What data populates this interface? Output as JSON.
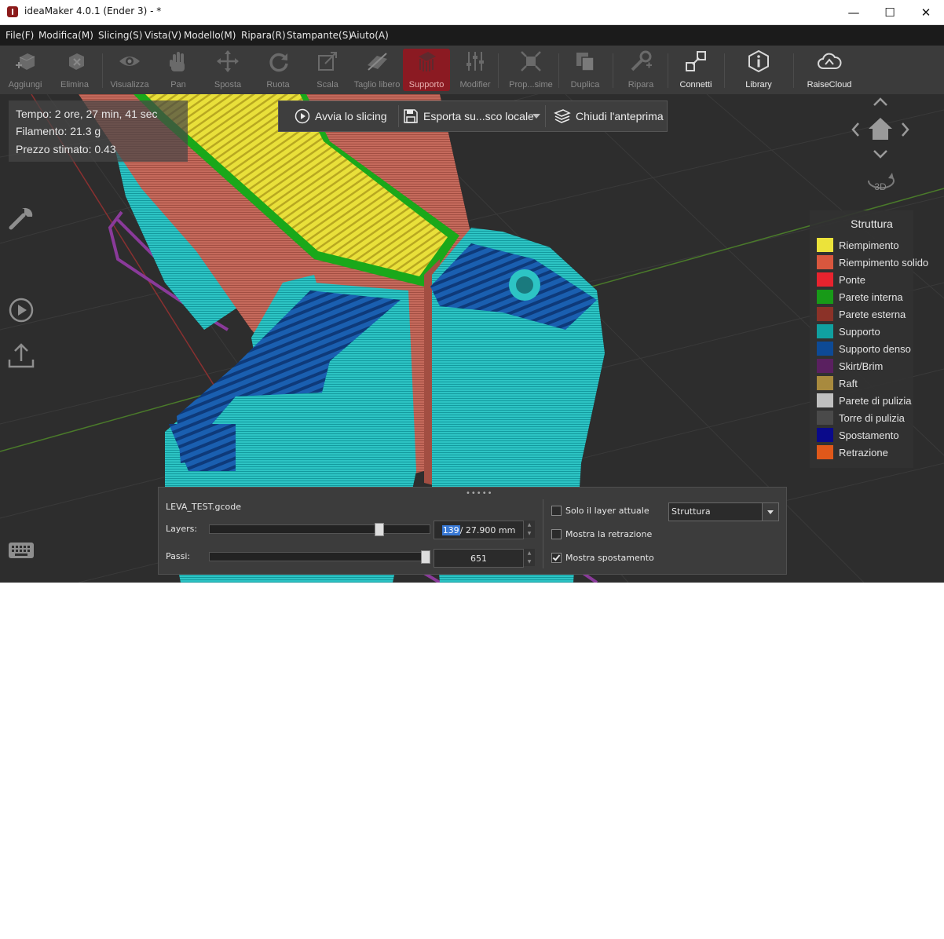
{
  "window": {
    "title": "ideaMaker 4.0.1 (Ender 3) - *",
    "minimize": "—",
    "maximize": "☐",
    "close": "✕"
  },
  "menu": [
    "File(F)",
    "Modifica(M)",
    "Slicing(S)",
    "Vista(V)",
    "Modello(M)",
    "Ripara(R)",
    "Stampante(S)",
    "Aiuto(A)"
  ],
  "toolbar": {
    "add": "Aggiungi",
    "delete": "Elimina",
    "view": "Visualizza",
    "pan": "Pan",
    "move": "Sposta",
    "rotate": "Ruota",
    "scale": "Scala",
    "freecut": "Taglio libero",
    "support": "Supporto",
    "modifier": "Modifier",
    "prop": "Prop...sime",
    "duplicate": "Duplica",
    "repair": "Ripara",
    "connect": "Connetti",
    "library": "Library",
    "raisecloud": "RaiseCloud"
  },
  "stats": {
    "time": "Tempo: 2 ore, 27 min, 41 sec",
    "filament": "Filamento: 21.3 g",
    "price": "Prezzo stimato: 0.43"
  },
  "actions": {
    "start": "Avvia lo slicing",
    "export": "Esporta su...sco locale",
    "close": "Chiudi l'anteprima"
  },
  "nav": {
    "mode": "3D"
  },
  "legend": {
    "title": "Struttura",
    "items": [
      {
        "label": "Riempimento",
        "color": "#ece33a"
      },
      {
        "label": "Riempimento solido",
        "color": "#d9573e"
      },
      {
        "label": "Ponte",
        "color": "#e8232e"
      },
      {
        "label": "Parete interna",
        "color": "#189a18"
      },
      {
        "label": "Parete esterna",
        "color": "#8b3228"
      },
      {
        "label": "Supporto",
        "color": "#10a0a0"
      },
      {
        "label": "Supporto denso",
        "color": "#0d4a96"
      },
      {
        "label": "Skirt/Brim",
        "color": "#5a2060"
      },
      {
        "label": "Raft",
        "color": "#a88a3e"
      },
      {
        "label": "Parete di pulizia",
        "color": "#c0c0c0"
      },
      {
        "label": "Torre di pulizia",
        "color": "#4a4a4a"
      },
      {
        "label": "Spostamento",
        "color": "#0a0a8a"
      },
      {
        "label": "Retrazione",
        "color": "#e0581a"
      }
    ]
  },
  "panel": {
    "filename": "LEVA_TEST.gcode",
    "layers_label": "Layers:",
    "layer_value": "139",
    "layer_height": " / 27.900 mm",
    "layer_fraction": 0.78,
    "steps_label": "Passi:",
    "steps_value": "651",
    "steps_fraction": 1.0,
    "only_current": "Solo il layer attuale",
    "show_retraction": "Mostra la retrazione",
    "show_travel": "Mostra spostamento",
    "view_mode": "Struttura"
  }
}
